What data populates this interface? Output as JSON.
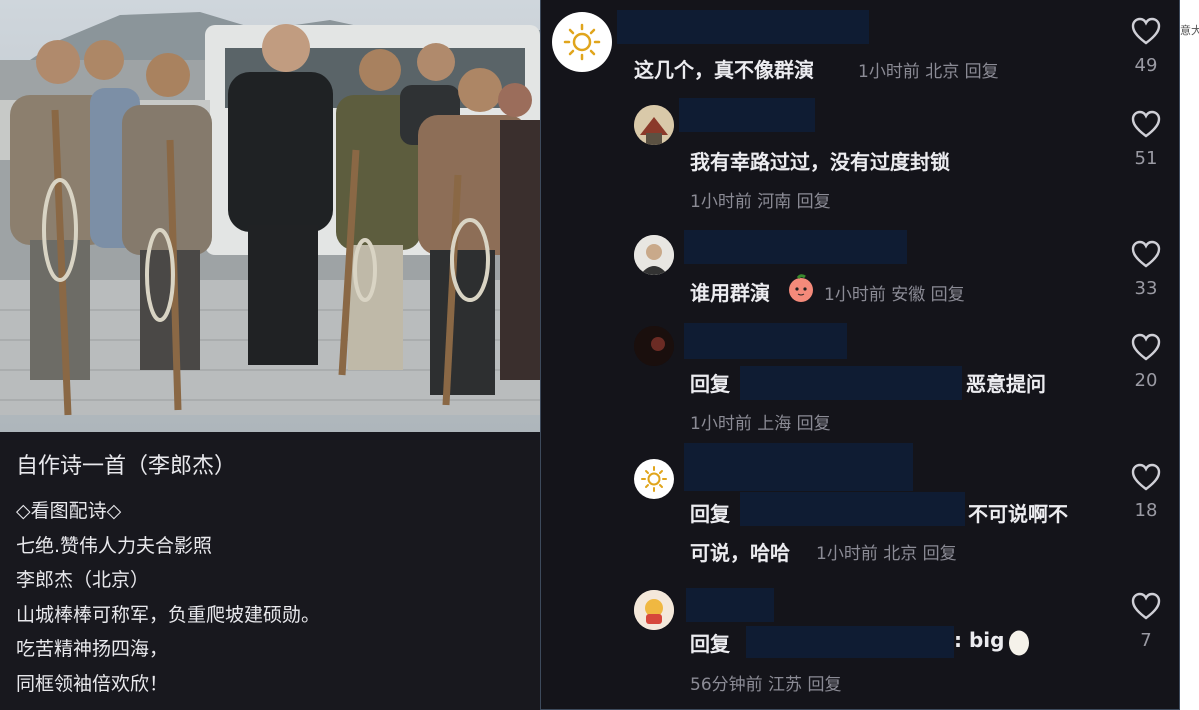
{
  "left": {
    "poem_title": "自作诗一首（李郎杰）",
    "lines": [
      "◇看图配诗◇",
      "七绝.赞伟人力夫合影照",
      "李郎杰（北京）",
      "山城棒棒可称军，负重爬坡建硕勋。",
      "吃苦精神扬四海，",
      "同框领袖倍欢欣！"
    ]
  },
  "comments": [
    {
      "text": "这几个，真不像群演",
      "time": "1小时前",
      "location": "北京",
      "reply": "回复",
      "likes": "49"
    },
    {
      "text": "我有幸路过过，没有过度封锁",
      "time": "1小时前",
      "location": "河南",
      "reply": "回复",
      "likes": "51"
    },
    {
      "text": "谁用群演",
      "time": "1小时前",
      "location": "安徽",
      "reply": "回复",
      "likes": "33"
    },
    {
      "prefix": "回复",
      "text": "恶意提问",
      "time": "1小时前",
      "location": "上海",
      "reply": "回复",
      "likes": "20"
    },
    {
      "prefix": "回复",
      "text": "不可说啊不",
      "text2": "可说，哈哈",
      "time": "1小时前",
      "location": "北京",
      "reply": "回复",
      "likes": "18"
    },
    {
      "prefix": "回复",
      "text": ": big",
      "time": "56分钟前",
      "location": "江苏",
      "reply": "回复",
      "likes": "7"
    }
  ],
  "edge_text": "意大",
  "colors": {
    "redaction": "#0f1c33",
    "bg": "#14141a",
    "meta": "#8b8b95"
  }
}
